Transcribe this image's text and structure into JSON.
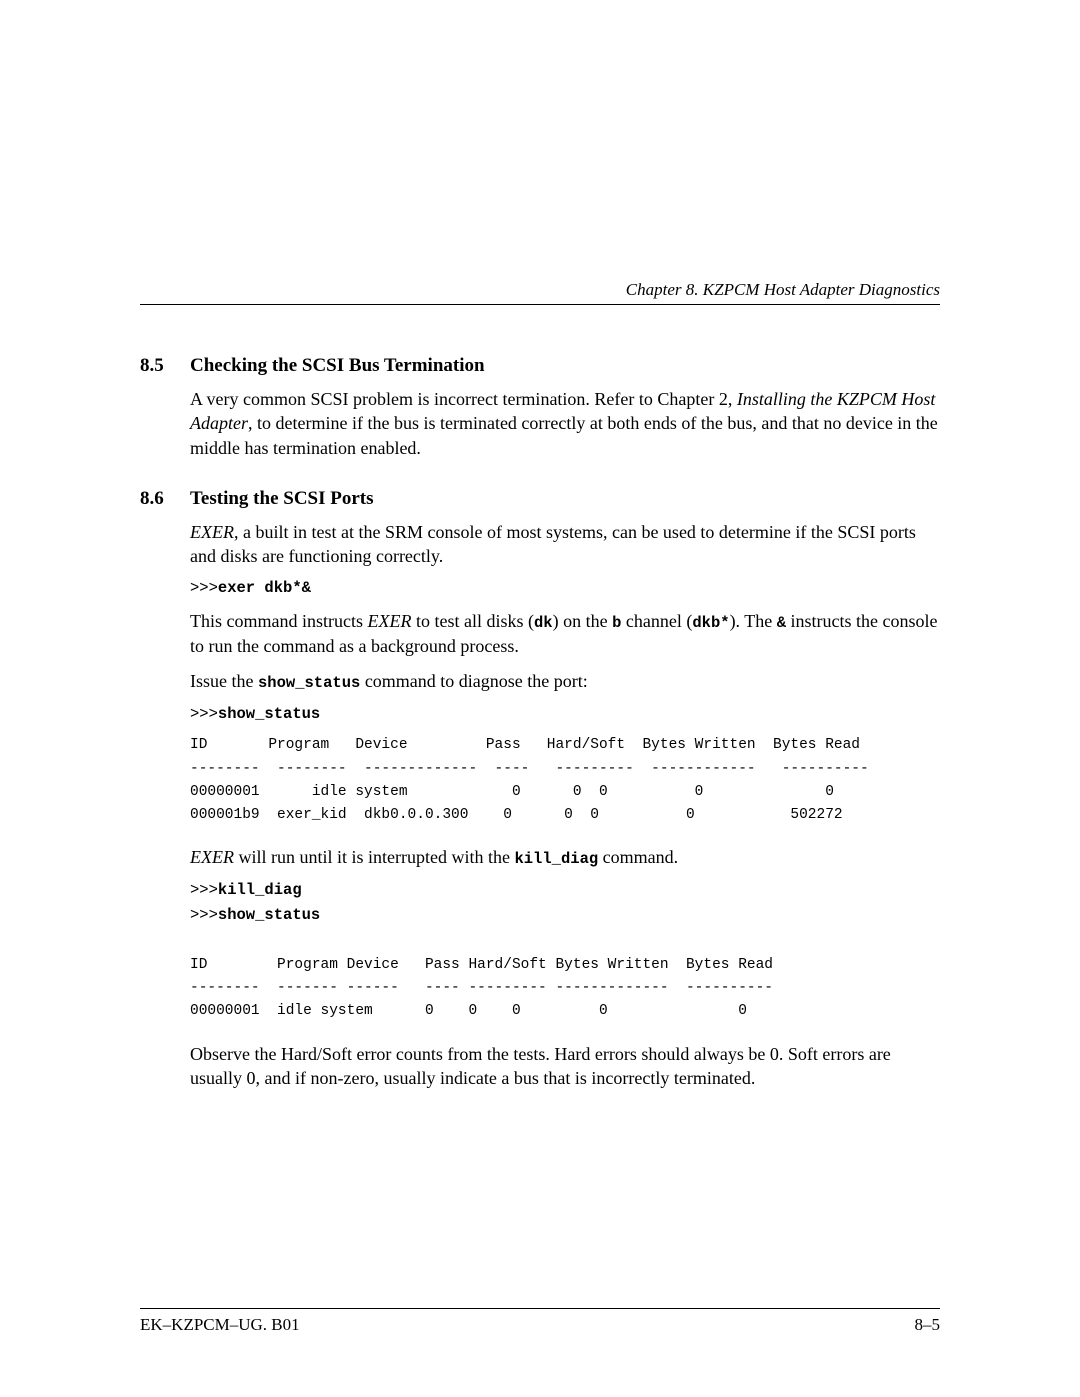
{
  "header": {
    "running": "Chapter 8. KZPCM Host Adapter Diagnostics"
  },
  "section85": {
    "num": "8.5",
    "title": "Checking the SCSI Bus Termination",
    "para_a": "A very common SCSI problem is incorrect termination.  Refer to Chapter 2, ",
    "para_ital": "Installing the KZPCM Host Adapter",
    "para_b": ", to determine if the bus is terminated correctly at both ends of the bus, and that no device in the middle has termination enabled."
  },
  "section86": {
    "num": "8.6",
    "title": "Testing the SCSI Ports",
    "p1_ital": "EXER",
    "p1_rest": ", a built in test at the SRM console of most systems, can be used to determine if the SCSI ports and disks are functioning correctly.",
    "cmd1_prefix": ">>>",
    "cmd1": "exer dkb*&",
    "p2_a": "This command instructs ",
    "p2_ital": "EXER",
    "p2_b": " to test all disks (",
    "p2_dk": "dk",
    "p2_c": ") on the ",
    "p2_bchan": "b",
    "p2_d": " channel (",
    "p2_dkbstar": "dkb*",
    "p2_e": "). The ",
    "p2_amp": "&",
    "p2_f": " instructs the console to run the command as a background process.",
    "p3_a": "Issue the ",
    "p3_cmd": "show_status",
    "p3_b": " command to diagnose the port:",
    "cmd2_prefix": ">>>",
    "cmd2": "show_status",
    "table1": "ID       Program   Device         Pass   Hard/Soft  Bytes Written  Bytes Read\n--------  --------  -------------  ----   ---------  ------------   ----------\n00000001      idle system            0      0  0          0              0\n000001b9  exer_kid  dkb0.0.0.300    0      0  0          0           502272",
    "p4_ital": "EXER",
    "p4_a": " will run until it is interrupted with the ",
    "p4_cmd": "kill_diag",
    "p4_b": " command.",
    "cmd3_prefix": ">>>",
    "cmd3": "kill_diag",
    "cmd4_prefix": ">>>",
    "cmd4": "show_status",
    "table2": "ID        Program Device   Pass Hard/Soft Bytes Written  Bytes Read\n--------  ------- ------   ---- --------- -------------  ----------\n00000001  idle system      0    0    0         0               0",
    "p5": "Observe the Hard/Soft error counts from the tests.  Hard errors should always be 0.  Soft errors are usually 0, and if non-zero, usually indicate a bus that is incorrectly terminated."
  },
  "footer": {
    "left": "EK–KZPCM–UG. B01",
    "right": "8–5"
  }
}
